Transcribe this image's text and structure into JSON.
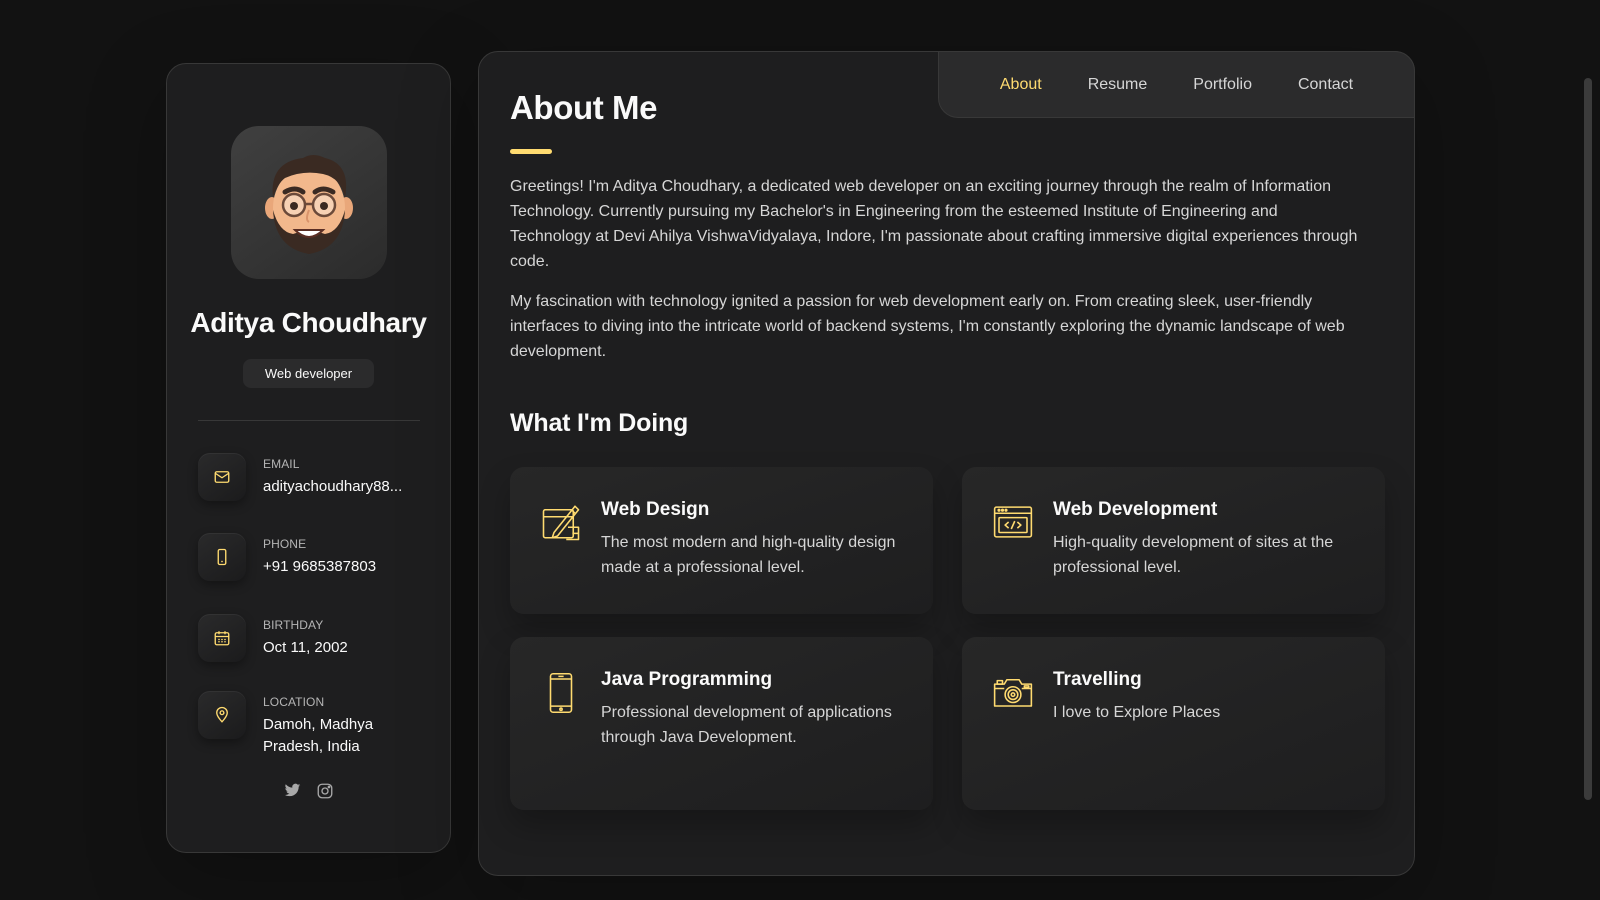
{
  "profile": {
    "name": "Aditya Choudhary",
    "title": "Web developer",
    "avatar_icon": "memoji-avatar"
  },
  "contacts": {
    "email": {
      "label": "Email",
      "value": "adityachoudhary88...",
      "icon": "mail-icon"
    },
    "phone": {
      "label": "Phone",
      "value": "+91 9685387803",
      "icon": "phone-icon"
    },
    "birthday": {
      "label": "Birthday",
      "value": "Oct 11, 2002",
      "icon": "calendar-icon"
    },
    "location": {
      "label": "Location",
      "value": "Damoh, Madhya Pradesh, India",
      "icon": "location-pin-icon"
    }
  },
  "social": [
    "twitter-icon",
    "instagram-icon"
  ],
  "nav": {
    "about": "About",
    "resume": "Resume",
    "portfolio": "Portfolio",
    "contact": "Contact",
    "active": "About"
  },
  "about": {
    "title": "About Me",
    "paragraph1": "Greetings! I'm Aditya Choudhary, a dedicated web developer on an exciting journey through the realm of Information Technology. Currently pursuing my Bachelor's in Engineering from the esteemed Institute of Engineering and Technology at Devi Ahilya VishwaVidyalaya, Indore, I'm passionate about crafting immersive digital experiences through code.",
    "paragraph2": "My fascination with technology ignited a passion for web development early on. From creating sleek, user-friendly interfaces to diving into the intricate world of backend systems, I'm constantly exploring the dynamic landscape of web development."
  },
  "services": {
    "title": "What I'm Doing",
    "items": [
      {
        "title": "Web Design",
        "text": "The most modern and high-quality design made at a professional level.",
        "icon": "design-icon"
      },
      {
        "title": "Web Development",
        "text": "High-quality development of sites at the professional level.",
        "icon": "code-window-icon"
      },
      {
        "title": "Java Programming",
        "text": "Professional development of applications through Java Development.",
        "icon": "mobile-icon"
      },
      {
        "title": "Travelling",
        "text": "I love to Explore Places",
        "icon": "camera-icon"
      }
    ]
  },
  "colors": {
    "accent": "#ffdb70",
    "background": "#121212",
    "card": "#1e1e1f",
    "text": "#d6d6d6"
  }
}
